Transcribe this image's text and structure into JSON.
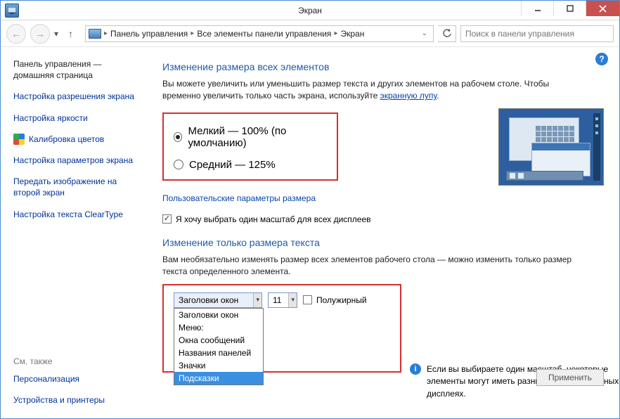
{
  "window": {
    "title": "Экран"
  },
  "breadcrumb": {
    "items": [
      "Панель управления",
      "Все элементы панели управления",
      "Экран"
    ]
  },
  "search": {
    "placeholder": "Поиск в панели управления"
  },
  "sidebar": {
    "items": [
      "Панель управления — домашняя страница",
      "Настройка разрешения экрана",
      "Настройка яркости",
      "Калибровка цветов",
      "Настройка параметров экрана",
      "Передать изображение на второй экран",
      "Настройка текста ClearType"
    ]
  },
  "seealso": {
    "header": "См. также",
    "items": [
      "Персонализация",
      "Устройства и принтеры"
    ]
  },
  "section1": {
    "title": "Изменение размера всех элементов",
    "desc_pre": "Вы можете увеличить или уменьшить размер текста и других элементов на рабочем столе. Чтобы временно увеличить только часть экрана, используйте ",
    "link": "экранную лупу",
    "desc_post": ".",
    "radio": {
      "opt1": "Мелкий — 100% (по умолчанию)",
      "opt2": "Средний — 125%"
    },
    "custom_link": "Пользовательские параметры размера",
    "checkbox_label": "Я хочу выбрать один масштаб для всех дисплеев"
  },
  "section2": {
    "title": "Изменение только размера текста",
    "desc": "Вам необязательно изменять размер всех элементов рабочего стола — можно изменить только размер текста определенного элемента.",
    "element_selected": "Заголовки окон",
    "size_selected": "11",
    "bold_label": "Полужирный",
    "dropdown_options": [
      "Заголовки окон",
      "Меню:",
      "Окна сообщений",
      "Названия панелей",
      "Значки",
      "Подсказки"
    ]
  },
  "info_note": "Если вы выбираете один масштаб, некоторые элементы могут иметь разный размер на разных дисплеях.",
  "apply": "Применить"
}
